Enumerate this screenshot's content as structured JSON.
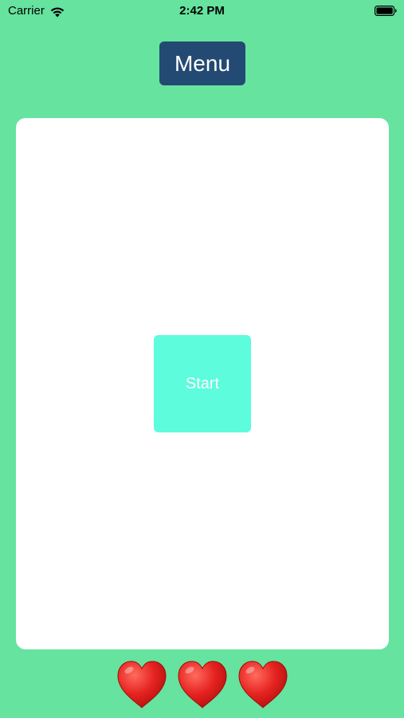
{
  "status_bar": {
    "carrier": "Carrier",
    "time": "2:42 PM",
    "wifi_icon": "wifi-icon",
    "battery_icon": "battery-icon"
  },
  "menu": {
    "label": "Menu",
    "color": "#234A72"
  },
  "board": {
    "start_label": "Start",
    "start_color": "#5CFCDC"
  },
  "lives": {
    "count": 3,
    "icon": "heart-icon",
    "color": "#E52320"
  },
  "background_color": "#66E39E"
}
